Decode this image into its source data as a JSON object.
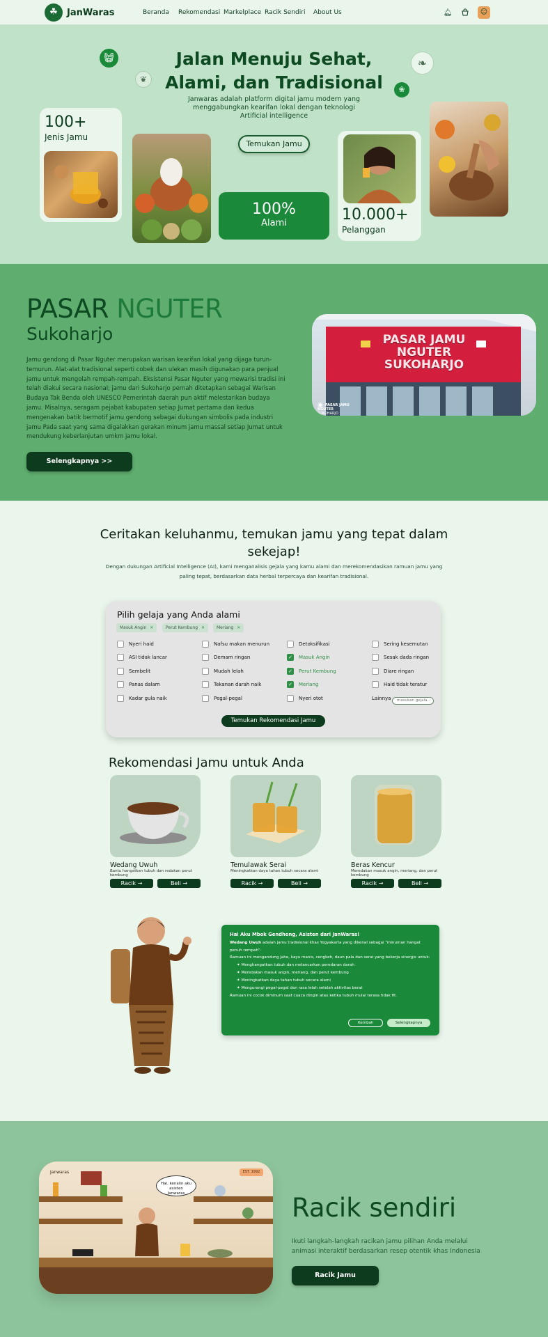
{
  "nav": {
    "brand": "JanWaras",
    "links": [
      "Beranda",
      "Rekomendasi",
      "Markelplace",
      "Racik Sendiri",
      "About Us"
    ]
  },
  "hero": {
    "title_line1": "Jalan Menuju Sehat,",
    "title_line2": "Alami, dan Tradisional",
    "subtitle": "Janwaras adalah platform digital jamu modern yang menggabungkan kearifan lokal dengan teknologi Artificial intelligence",
    "cta": "Temukan Jamu",
    "stat1_num": "100+",
    "stat1_label": "Jenis Jamu",
    "stat2_num": "100%",
    "stat2_label": "Alami",
    "stat3_num": "10.000+",
    "stat3_label": "Pelanggan"
  },
  "pasar": {
    "title_a": "PASAR",
    "title_b": "NGUTER",
    "subtitle": "Sukoharjo",
    "body": "Jamu gendong di Pasar Nguter merupakan warisan kearifan lokal yang dijaga turun-temurun. Alat-alat tradisional seperti cobek dan ulekan masih digunakan para penjual jamu untuk mengolah rempah-rempah. Eksistensi Pasar Nguter yang mewarisi tradisi ini telah diakui secara nasional; jamu dari Sukoharjo pernah ditetapkan sebagai Warisan Budaya Tak Benda oleh UNESCO Pemerintah daerah pun aktif melestarikan budaya jamu. Misalnya, seragam pejabat kabupaten setiap Jumat pertama dan kedua mengenakan batik bermotif jamu gendong sebagai dukungan simbolis pada industri jamu Pada saat yang sama digalakkan gerakan minum jamu massal setiap Jumat untuk mendukung keberlanjutan umkm jamu lokal.",
    "button": "Selengkapnya >>",
    "sign_line1": "PASAR JAMU",
    "sign_line2": "NGUTER",
    "sign_line3": "SUKOHARJO",
    "photo_caption": "PASAR JAMU NGUTER",
    "photo_caption2": "SUKOHARJO"
  },
  "keluhan": {
    "title": "Ceritakan keluhanmu, temukan jamu yang tepat dalam sekejap!",
    "subtitle": "Dengan dukungan Artificial Intelligence (AI), kami menganalisis gejala yang kamu alami dan merekomendasikan ramuan jamu yang paling tepat, berdasarkan data herbal terpercaya dan kearifan tradisional.",
    "panel_title": "Pilih gelaja yang Anda alami",
    "chips": [
      "Masuk Angin",
      "Perut Kembung",
      "Meriang"
    ],
    "col1": [
      "Nyeri haid",
      "ASI tidak lancar",
      "Sembelit",
      "Panas dalam",
      "Kadar gula naik"
    ],
    "col2": [
      "Nafsu makan menurun",
      "Demam ringan",
      "Mudah lelah",
      "Tekanan darah naik",
      "Pegal-pegal"
    ],
    "col3": [
      "Detoksifikasi",
      "Masuk Angin",
      "Perut Kembung",
      "Meriang",
      "Nyeri otot"
    ],
    "col3_checked": [
      false,
      true,
      true,
      true,
      false
    ],
    "col4": [
      "Sering kesemutan",
      "Sesak dada ringan",
      "Diare ringan",
      "Haid tidak teratur"
    ],
    "other_label": "Lainnya",
    "other_placeholder": "masukan gejala...",
    "find_button": "Temukan Rekomendasi Jamu",
    "rek_title": "Rekomendasi Jamu untuk Anda",
    "products": [
      {
        "name": "Wedang Uwuh",
        "desc": "Bantu hangatkan tubuh dan redakan perut kembung",
        "racik": "Racik",
        "beli": "Beli"
      },
      {
        "name": "Temulawak Serai",
        "desc": "Meningkatkan daya tahan tubuh secara alami",
        "racik": "Racik",
        "beli": "Beli"
      },
      {
        "name": "Beras Kencur",
        "desc": "Meredakan masuk angin, meriang, dan perut kembung",
        "racik": "Racik",
        "beli": "Beli"
      }
    ],
    "chat": {
      "title": "Hai Aku Mbok Gendhong, Asisten dari JanWaras!",
      "p1_bold": "Wedang Uwuh",
      "p1": " adalah jamu tradisional khas Yogyakarta yang dikenal sebagai \"minuman hangat penuh rempah\".",
      "p2": "Ramuan ini mengandung jahe, kayu manis, cengkeh, daun pala dan serai yang bekerja sinergis untuk:",
      "list": [
        "Menghangatkan tubuh dan melancarkan peredaran darah",
        "Meredakan masuk angin, meriang, dan perut kembung",
        "Meningkatkan daya tahan tubuh secara alami",
        "Mengurangi pegal-pegal dan rasa lelah setelah aktivitas berat"
      ],
      "p3": "Ramuan ini cocok diminum saat cuaca dingin atau ketika tubuh mulai terasa tidak fit.",
      "btn_back": "Kembali",
      "btn_more": "Selengkapnya"
    }
  },
  "racik": {
    "title": "Racik sendiri",
    "desc": "Ikuti langkah-langkah racikan jamu pilihan Anda melalui animasi interaktif berdasarkan resep otentik khas Indonesia",
    "button": "Racik Jamu",
    "scene_brand": "Janwaras",
    "scene_badge": "EST. 1992",
    "scene_bubble": "Hai, kenalin aku asisten Janwaras"
  },
  "colors": {
    "dark_green": "#0d3b1e",
    "accent_green": "#1a8a3a",
    "hero_bg": "#c0e2c8",
    "pasar_bg": "#5fad6f",
    "racik_bg": "#8dc49b"
  }
}
